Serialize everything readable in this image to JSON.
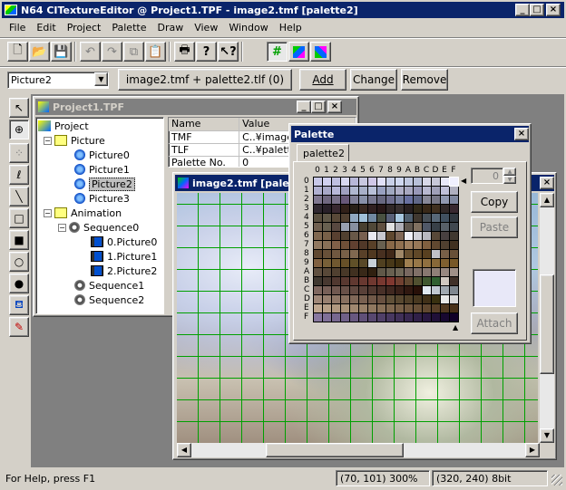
{
  "app": {
    "title": "N64 CITextureEditor @ Project1.TPF - image2.tmf [palette2]"
  },
  "menu": [
    "File",
    "Edit",
    "Project",
    "Palette",
    "Draw",
    "View",
    "Window",
    "Help"
  ],
  "toolbar": {
    "icons": [
      "new-icon",
      "open-icon",
      "save-icon",
      "undo-icon",
      "redo-icon",
      "copy-icon",
      "paste-icon",
      "print-icon",
      "help-icon",
      "context-help-icon",
      "grid-icon",
      "cube-icon",
      "cube-alt-icon"
    ]
  },
  "picture_bar": {
    "select_value": "Picture2",
    "label": "image2.tmf + palette2.tlf (0)",
    "add": "Add",
    "change": "Change",
    "remove": "Remove"
  },
  "project_window": {
    "title": "Project1.TPF",
    "tree": {
      "root": "Project",
      "picture_folder": "Picture",
      "pictures": [
        "Picture0",
        "Picture1",
        "Picture2",
        "Picture3"
      ],
      "animation_folder": "Animation",
      "sequence0": "Sequence0",
      "frames": [
        "0.Picture0",
        "1.Picture1",
        "2.Picture2"
      ],
      "sequence1": "Sequence1",
      "sequence2": "Sequence2"
    },
    "props": {
      "col_name": "Name",
      "col_value": "Value",
      "rows": [
        {
          "name": "TMF",
          "value": "C..¥image"
        },
        {
          "name": "TLF",
          "value": "C..¥palette"
        },
        {
          "name": "Palette No.",
          "value": "0"
        }
      ]
    }
  },
  "image_window": {
    "title": "image2.tmf [palette2]"
  },
  "palette_window": {
    "title": "Palette",
    "tab": "palette2",
    "hex_labels": [
      "0",
      "1",
      "2",
      "3",
      "4",
      "5",
      "6",
      "7",
      "8",
      "9",
      "A",
      "B",
      "C",
      "D",
      "E",
      "F"
    ],
    "spin_value": "0",
    "copy": "Copy",
    "paste": "Paste",
    "attach": "Attach"
  },
  "status": {
    "help": "For Help, press F1",
    "position_zoom": "(70, 101) 300%",
    "size_depth": "(320, 240) 8bit"
  },
  "colors": {
    "active_title": "#0a246a",
    "inactive_title": "#808080",
    "selection": "#0a246a",
    "grid_line": "#00a000"
  }
}
